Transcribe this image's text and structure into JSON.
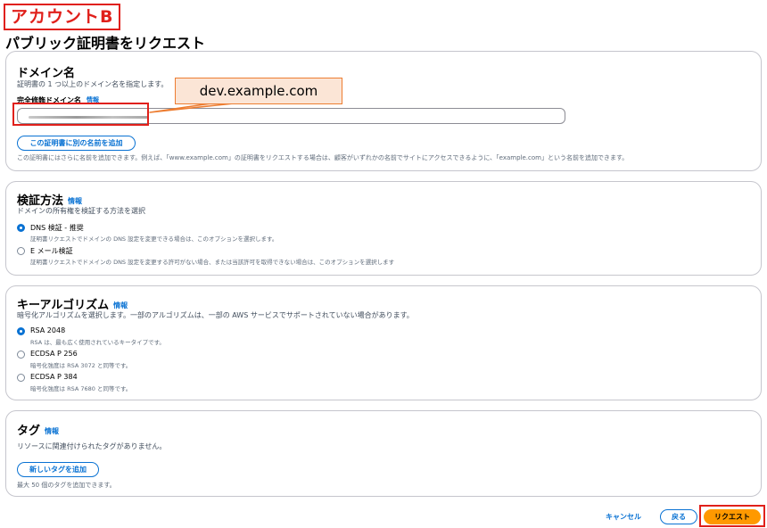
{
  "account_label": "アカウントB",
  "page_title": "パブリック証明書をリクエスト",
  "domain_section": {
    "title": "ドメイン名",
    "description": "証明書の 1 つ以上のドメイン名を指定します。",
    "field_label": "完全修飾ドメイン名",
    "info_label": "情報",
    "add_name_button": "この証明書に別の名前を追加",
    "footer_note": "この証明書にはさらに名前を追加できます。例えば、「www.example.com」の証明書をリクエストする場合は、顧客がいずれかの名前でサイトにアクセスできるように、「example.com」という名前を追加できます。"
  },
  "callout_text": "dev.example.com",
  "validation_section": {
    "title": "検証方法",
    "info_label": "情報",
    "description": "ドメインの所有権を検証する方法を選択",
    "options": [
      {
        "label": "DNS 検証 - 推奨",
        "sub": "証明書リクエストでドメインの DNS 設定を変更できる場合は、このオプションを選択します。",
        "checked": true
      },
      {
        "label": "E メール検証",
        "sub": "証明書リクエストでドメインの DNS 設定を変更する許可がない場合、または当該許可を取得できない場合は、このオプションを選択します",
        "checked": false
      }
    ]
  },
  "algorithm_section": {
    "title": "キーアルゴリズム",
    "info_label": "情報",
    "description": "暗号化アルゴリズムを選択します。一部のアルゴリズムは、一部の AWS サービスでサポートされていない場合があります。",
    "options": [
      {
        "label": "RSA 2048",
        "sub": "RSA は、最も広く使用されているキータイプです。",
        "checked": true
      },
      {
        "label": "ECDSA P 256",
        "sub": "暗号化強度は RSA 3072 と同等です。",
        "checked": false
      },
      {
        "label": "ECDSA P 384",
        "sub": "暗号化強度は RSA 7680 と同等です。",
        "checked": false
      }
    ]
  },
  "tags_section": {
    "title": "タグ",
    "info_label": "情報",
    "description": "リソースに関連付けられたタグがありません。",
    "add_tag_button": "新しいタグを追加",
    "limit_note": "最大 50 個のタグを追加できます。"
  },
  "footer": {
    "cancel": "キャンセル",
    "back": "戻る",
    "submit": "リクエスト"
  },
  "colors": {
    "accent": "#0972d3",
    "primary_button": "#ff9900",
    "highlight_red": "#e0201b",
    "callout_fill": "#fbe5d6",
    "callout_border": "#ed7d31"
  }
}
